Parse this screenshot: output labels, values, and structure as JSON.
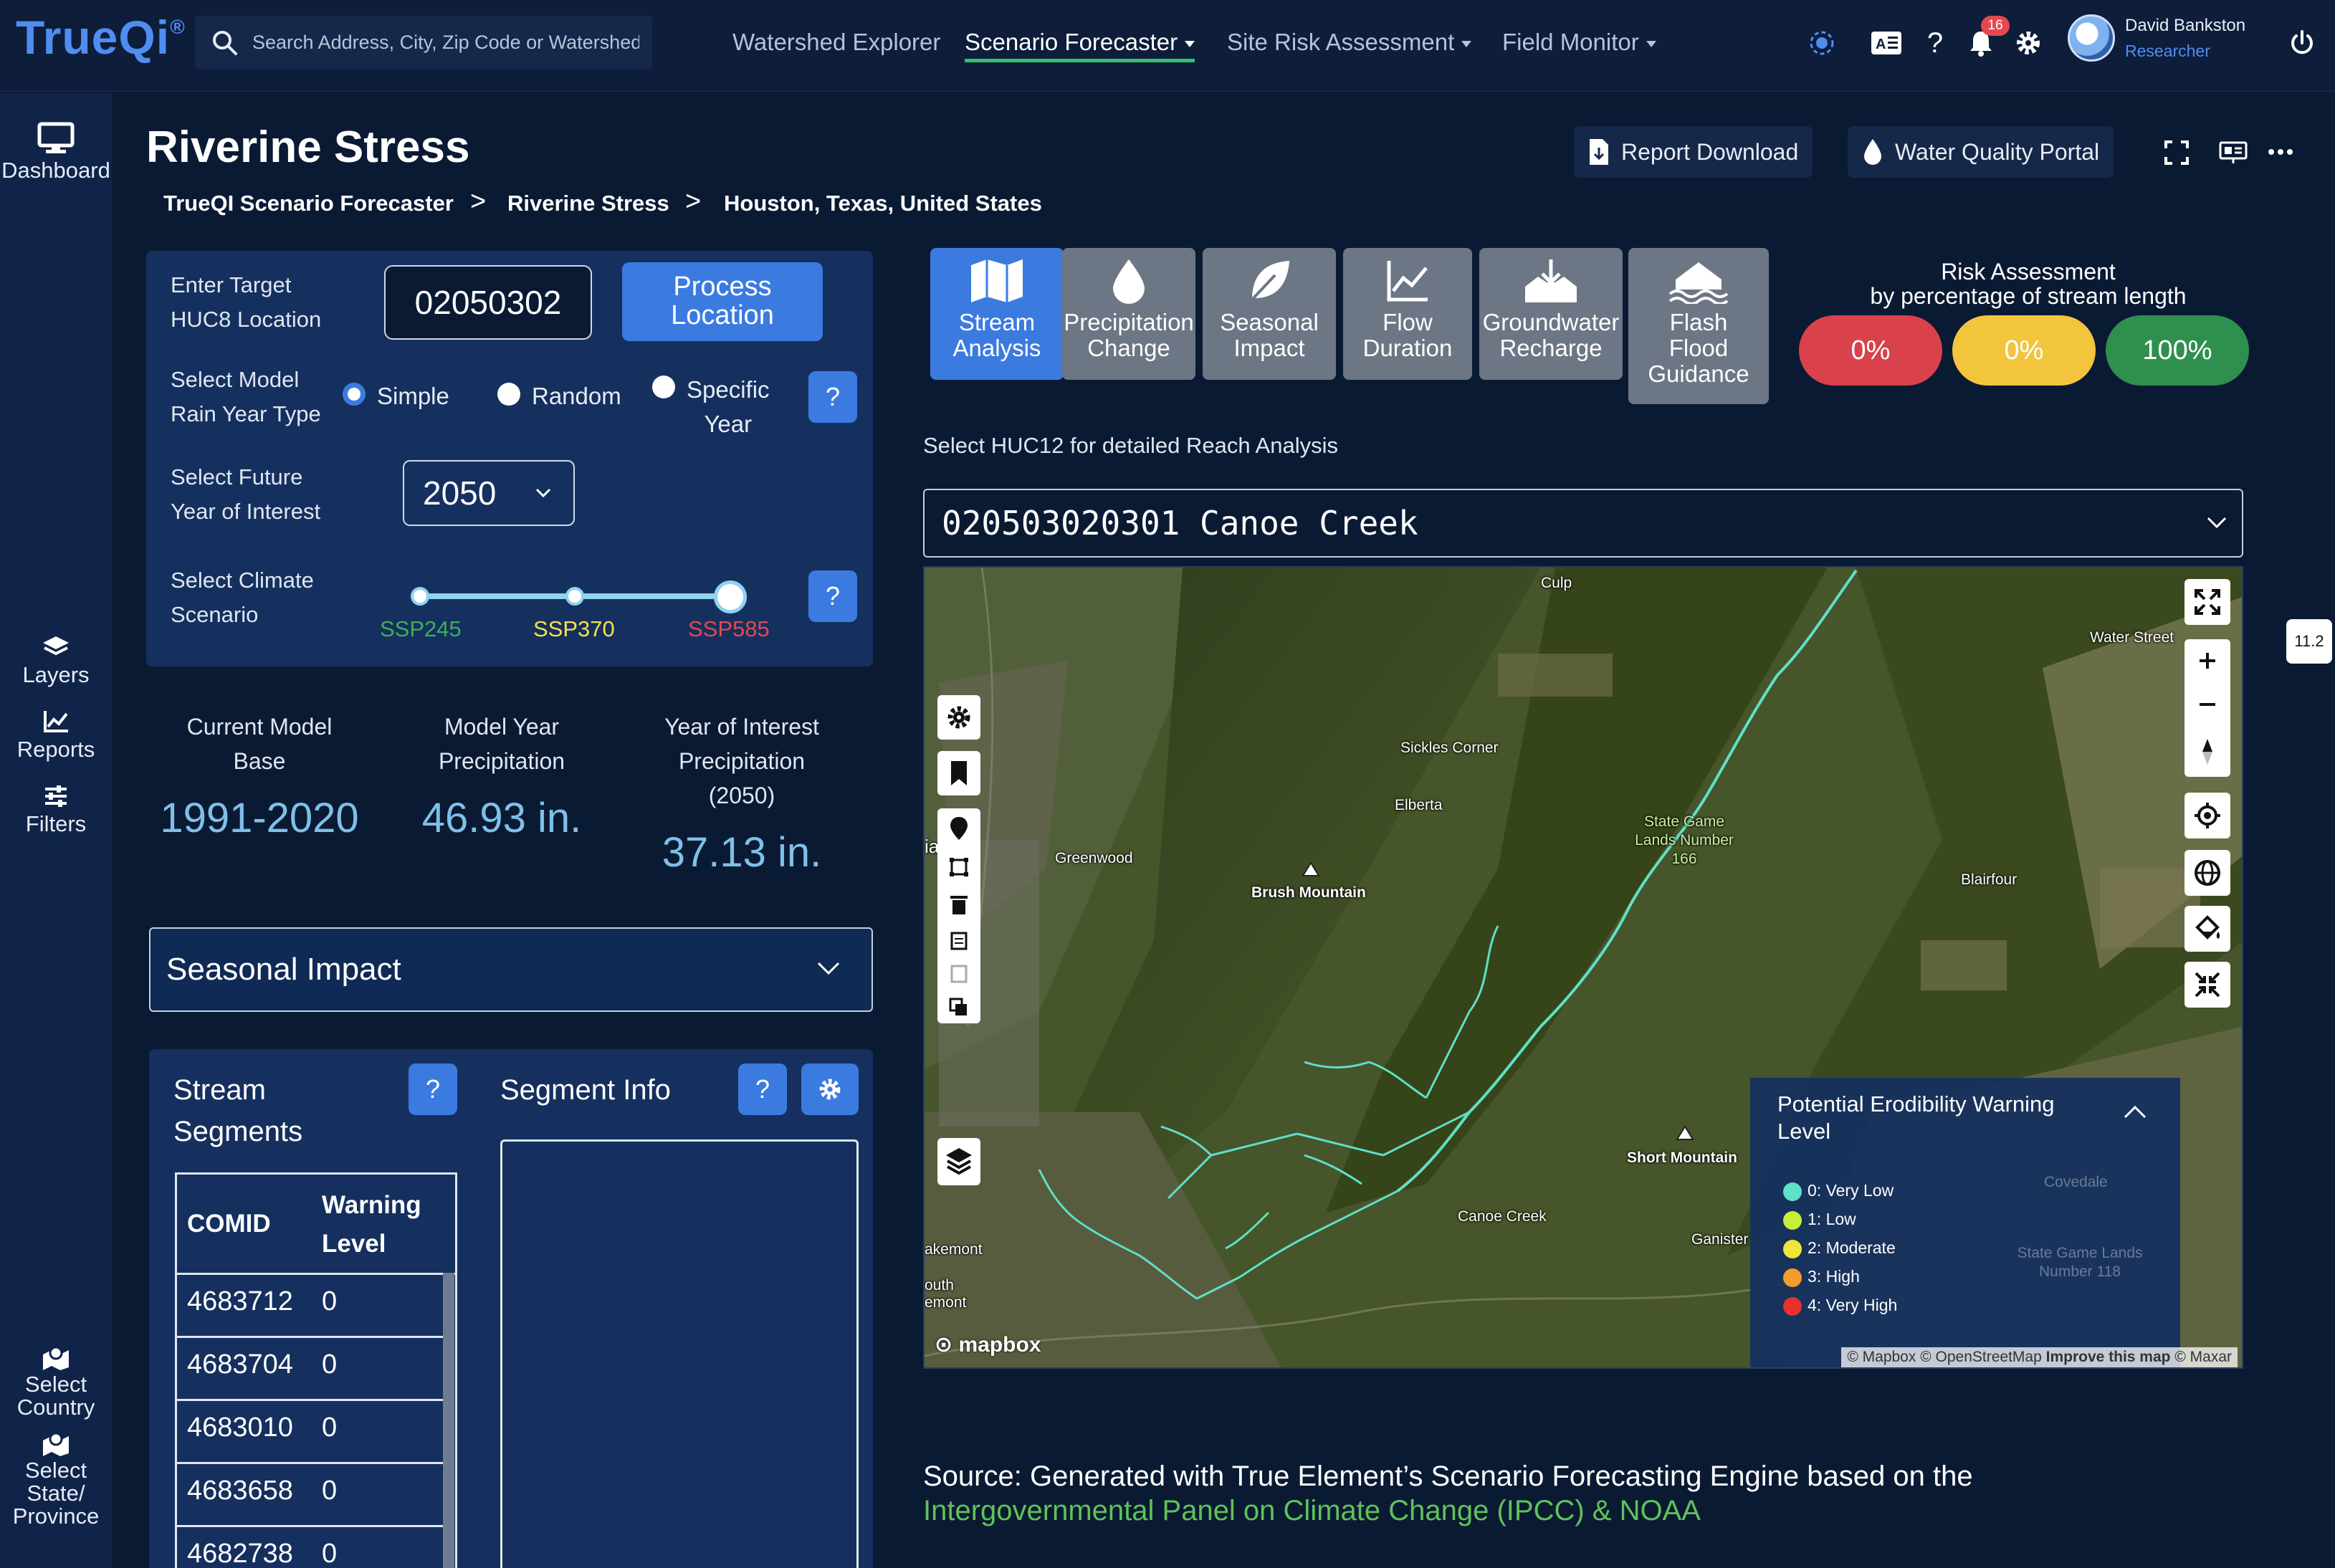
{
  "app": {
    "logo": "TrueQi",
    "logo_mark": "®",
    "search_placeholder": "Search Address, City, Zip Code or Watershed",
    "nav": [
      {
        "label": "Watershed Explorer"
      },
      {
        "label": "Scenario Forecaster",
        "active": true
      },
      {
        "label": "Site Risk Assessment"
      },
      {
        "label": "Field Monitor"
      }
    ],
    "notification_count": "16",
    "user": {
      "name": "David Bankston",
      "role": "Researcher"
    },
    "icons": [
      "target-icon",
      "ad-icon",
      "help-icon",
      "bell-icon",
      "gear-icon",
      "power-icon"
    ]
  },
  "sidebar": {
    "top": [
      {
        "label": "Dashboard",
        "icon": "monitor-icon"
      }
    ],
    "middle": [
      {
        "label": "Layers",
        "icon": "layers-icon"
      },
      {
        "label": "Reports",
        "icon": "chart-icon"
      },
      {
        "label": "Filters",
        "icon": "sliders-icon"
      }
    ],
    "bottom": [
      {
        "label_lines": [
          "Select",
          "Country"
        ],
        "icon": "map-pin-icon"
      },
      {
        "label_lines": [
          "Select",
          "State/",
          "Province"
        ],
        "icon": "map-pin-icon"
      }
    ]
  },
  "header": {
    "title": "Riverine Stress",
    "breadcrumb": [
      "TrueQI Scenario Forecaster",
      "Riverine Stress",
      "Houston, Texas, United States"
    ],
    "breadcrumb_separator": ">",
    "report_download": "Report Download",
    "water_quality_portal": "Water Quality Portal"
  },
  "controls": {
    "huc8_label": [
      "Enter Target",
      "HUC8 Location"
    ],
    "huc8_value": "02050302",
    "process_label": [
      "Process",
      "Location"
    ],
    "model_label": [
      "Select Model",
      "Rain Year Type"
    ],
    "rain_options": [
      {
        "label": "Simple",
        "selected": true
      },
      {
        "label": "Random",
        "selected": false
      },
      {
        "label": "Specific Year",
        "label_lines": [
          "Specific",
          "Year"
        ],
        "selected": false
      }
    ],
    "future_year_label": [
      "Select Future",
      "Year of Interest"
    ],
    "future_year_value": "2050",
    "climate_label": [
      "Select Climate",
      "Scenario"
    ],
    "scenarios": [
      {
        "label": "SSP245",
        "color": "#3fae5a"
      },
      {
        "label": "SSP370",
        "color": "#f3e24c"
      },
      {
        "label": "SSP585",
        "color": "#e5484d"
      }
    ],
    "selected_scenario": "SSP585",
    "help": "?"
  },
  "stats": [
    {
      "label_lines": [
        "Current Model",
        "Base"
      ],
      "value": "1991-2020"
    },
    {
      "label_lines": [
        "Model Year",
        "Precipitation"
      ],
      "value": "46.93 in."
    },
    {
      "label_lines": [
        "Year of Interest",
        "Precipitation",
        "(2050)"
      ],
      "value": "37.13 in."
    }
  ],
  "impact_dropdown": "Seasonal Impact",
  "segments": {
    "title_lines": [
      "Stream",
      "Segments"
    ],
    "info_title": "Segment Info",
    "columns": [
      "COMID",
      "Warning Level"
    ],
    "column_lines": [
      [
        "COMID"
      ],
      [
        "Warning",
        "Level"
      ]
    ],
    "rows": [
      [
        "4683712",
        "0"
      ],
      [
        "4683704",
        "0"
      ],
      [
        "4683010",
        "0"
      ],
      [
        "4683658",
        "0"
      ],
      [
        "4682738",
        "0"
      ]
    ]
  },
  "tiles": [
    {
      "label_lines": [
        "Stream",
        "Analysis"
      ],
      "icon": "map-icon",
      "active": true
    },
    {
      "label_lines": [
        "Precipitation",
        "Change"
      ],
      "icon": "droplet-icon",
      "active": false
    },
    {
      "label_lines": [
        "Seasonal",
        "Impact"
      ],
      "icon": "leaf-icon",
      "active": false
    },
    {
      "label_lines": [
        "Flow",
        "Duration"
      ],
      "icon": "line-chart-icon",
      "active": false
    },
    {
      "label_lines": [
        "Groundwater",
        "Recharge"
      ],
      "icon": "groundwater-icon",
      "active": false
    },
    {
      "label_lines": [
        "Flash",
        "Flood",
        "Guidance"
      ],
      "icon": "flood-icon",
      "active": false
    }
  ],
  "risk": {
    "title_lines": [
      "Risk Assessment",
      "by percentage of stream length"
    ],
    "pills": [
      {
        "value": "0%",
        "color": "#d9414b"
      },
      {
        "value": "0%",
        "color": "#f2c53d"
      },
      {
        "value": "100%",
        "color": "#2f8f4e"
      }
    ]
  },
  "huc12": {
    "label": "Select HUC12 for detailed Reach Analysis",
    "value": "020503020301 Canoe Creek"
  },
  "map": {
    "labels": [
      {
        "text": "Culp"
      },
      {
        "text": "Water Street"
      },
      {
        "text": "Sickles Corner"
      },
      {
        "text": "Elberta"
      },
      {
        "text": "State Game Lands Number 166"
      },
      {
        "text": "Greenwood"
      },
      {
        "text": "Brush Mountain"
      },
      {
        "text": "Blairfour"
      },
      {
        "text": "iata"
      },
      {
        "text": "Short Mountain"
      },
      {
        "text": "Canoe Creek"
      },
      {
        "text": "Ganister"
      },
      {
        "text": "akemont"
      },
      {
        "text": "outh"
      },
      {
        "text": "emont"
      },
      {
        "text": "Covedale"
      },
      {
        "text": "State Game Lands Number 118"
      }
    ],
    "logo": "mapbox",
    "attribution": "© Mapbox © OpenStreetMap",
    "improve": "Improve this map",
    "attribution_tail": "© Maxar",
    "zoom": "11.2",
    "legend": {
      "title": "Potential Erodibility Warning Level",
      "items": [
        {
          "label": "0: Very Low",
          "color": "#5fe0c8"
        },
        {
          "label": "1: Low",
          "color": "#c6ef3b"
        },
        {
          "label": "2: Moderate",
          "color": "#f0e63a"
        },
        {
          "label": "3: High",
          "color": "#f39c2e"
        },
        {
          "label": "4: Very High",
          "color": "#e8302c"
        }
      ]
    },
    "stream_color": "#5fe0c8"
  },
  "source": {
    "text": "Source: Generated with True Element’s Scenario Forecasting Engine based on the",
    "link": "Intergovernmental Panel on Climate Change (IPCC) & NOAA"
  }
}
